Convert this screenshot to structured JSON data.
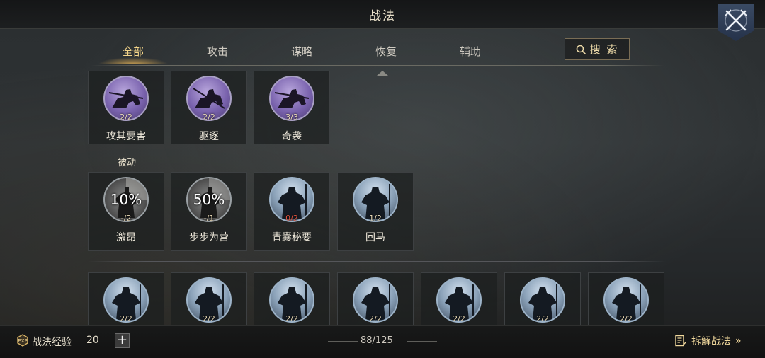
{
  "header": {
    "title": "战法"
  },
  "tabs": [
    {
      "label": "全部",
      "active": true
    },
    {
      "label": "攻击",
      "active": false
    },
    {
      "label": "谋略",
      "active": false
    },
    {
      "label": "恢复",
      "active": false
    },
    {
      "label": "辅助",
      "active": false
    }
  ],
  "search": {
    "label": "搜 索"
  },
  "active_skills": [
    {
      "name": "攻其要害",
      "count": "2/2",
      "icon": "rider-silhouette-icon"
    },
    {
      "name": "驱逐",
      "count": "2/2",
      "icon": "rider-silhouette-icon"
    },
    {
      "name": "奇袭",
      "count": "3/3",
      "icon": "rider-silhouette-icon"
    }
  ],
  "passive": {
    "label": "被动",
    "skills": [
      {
        "name": "激昂",
        "percent": "10%",
        "count": "-/2"
      },
      {
        "name": "步步为营",
        "percent": "50%",
        "count": "-/1"
      },
      {
        "name": "青囊秘要",
        "count": "0/2",
        "count_color": "#e2543e"
      },
      {
        "name": "回马",
        "count": "1/2"
      }
    ]
  },
  "more_skills": [
    {
      "count": "2/2"
    },
    {
      "count": "2/2"
    },
    {
      "count": "2/2"
    },
    {
      "count": "2/2"
    },
    {
      "count": "2/2"
    },
    {
      "count": "2/2"
    },
    {
      "count": "2/2"
    }
  ],
  "footer": {
    "exp_label": "战法经验",
    "exp_value": "20",
    "plus": "+",
    "page": "88/125",
    "decompose_label": "拆解战法",
    "decompose_arrow": "»"
  },
  "colors": {
    "accent_gold": "#f3d489",
    "purple_icon": "#7a63ae",
    "blue_icon": "#8aa1b8",
    "warning_red": "#e2543e"
  }
}
